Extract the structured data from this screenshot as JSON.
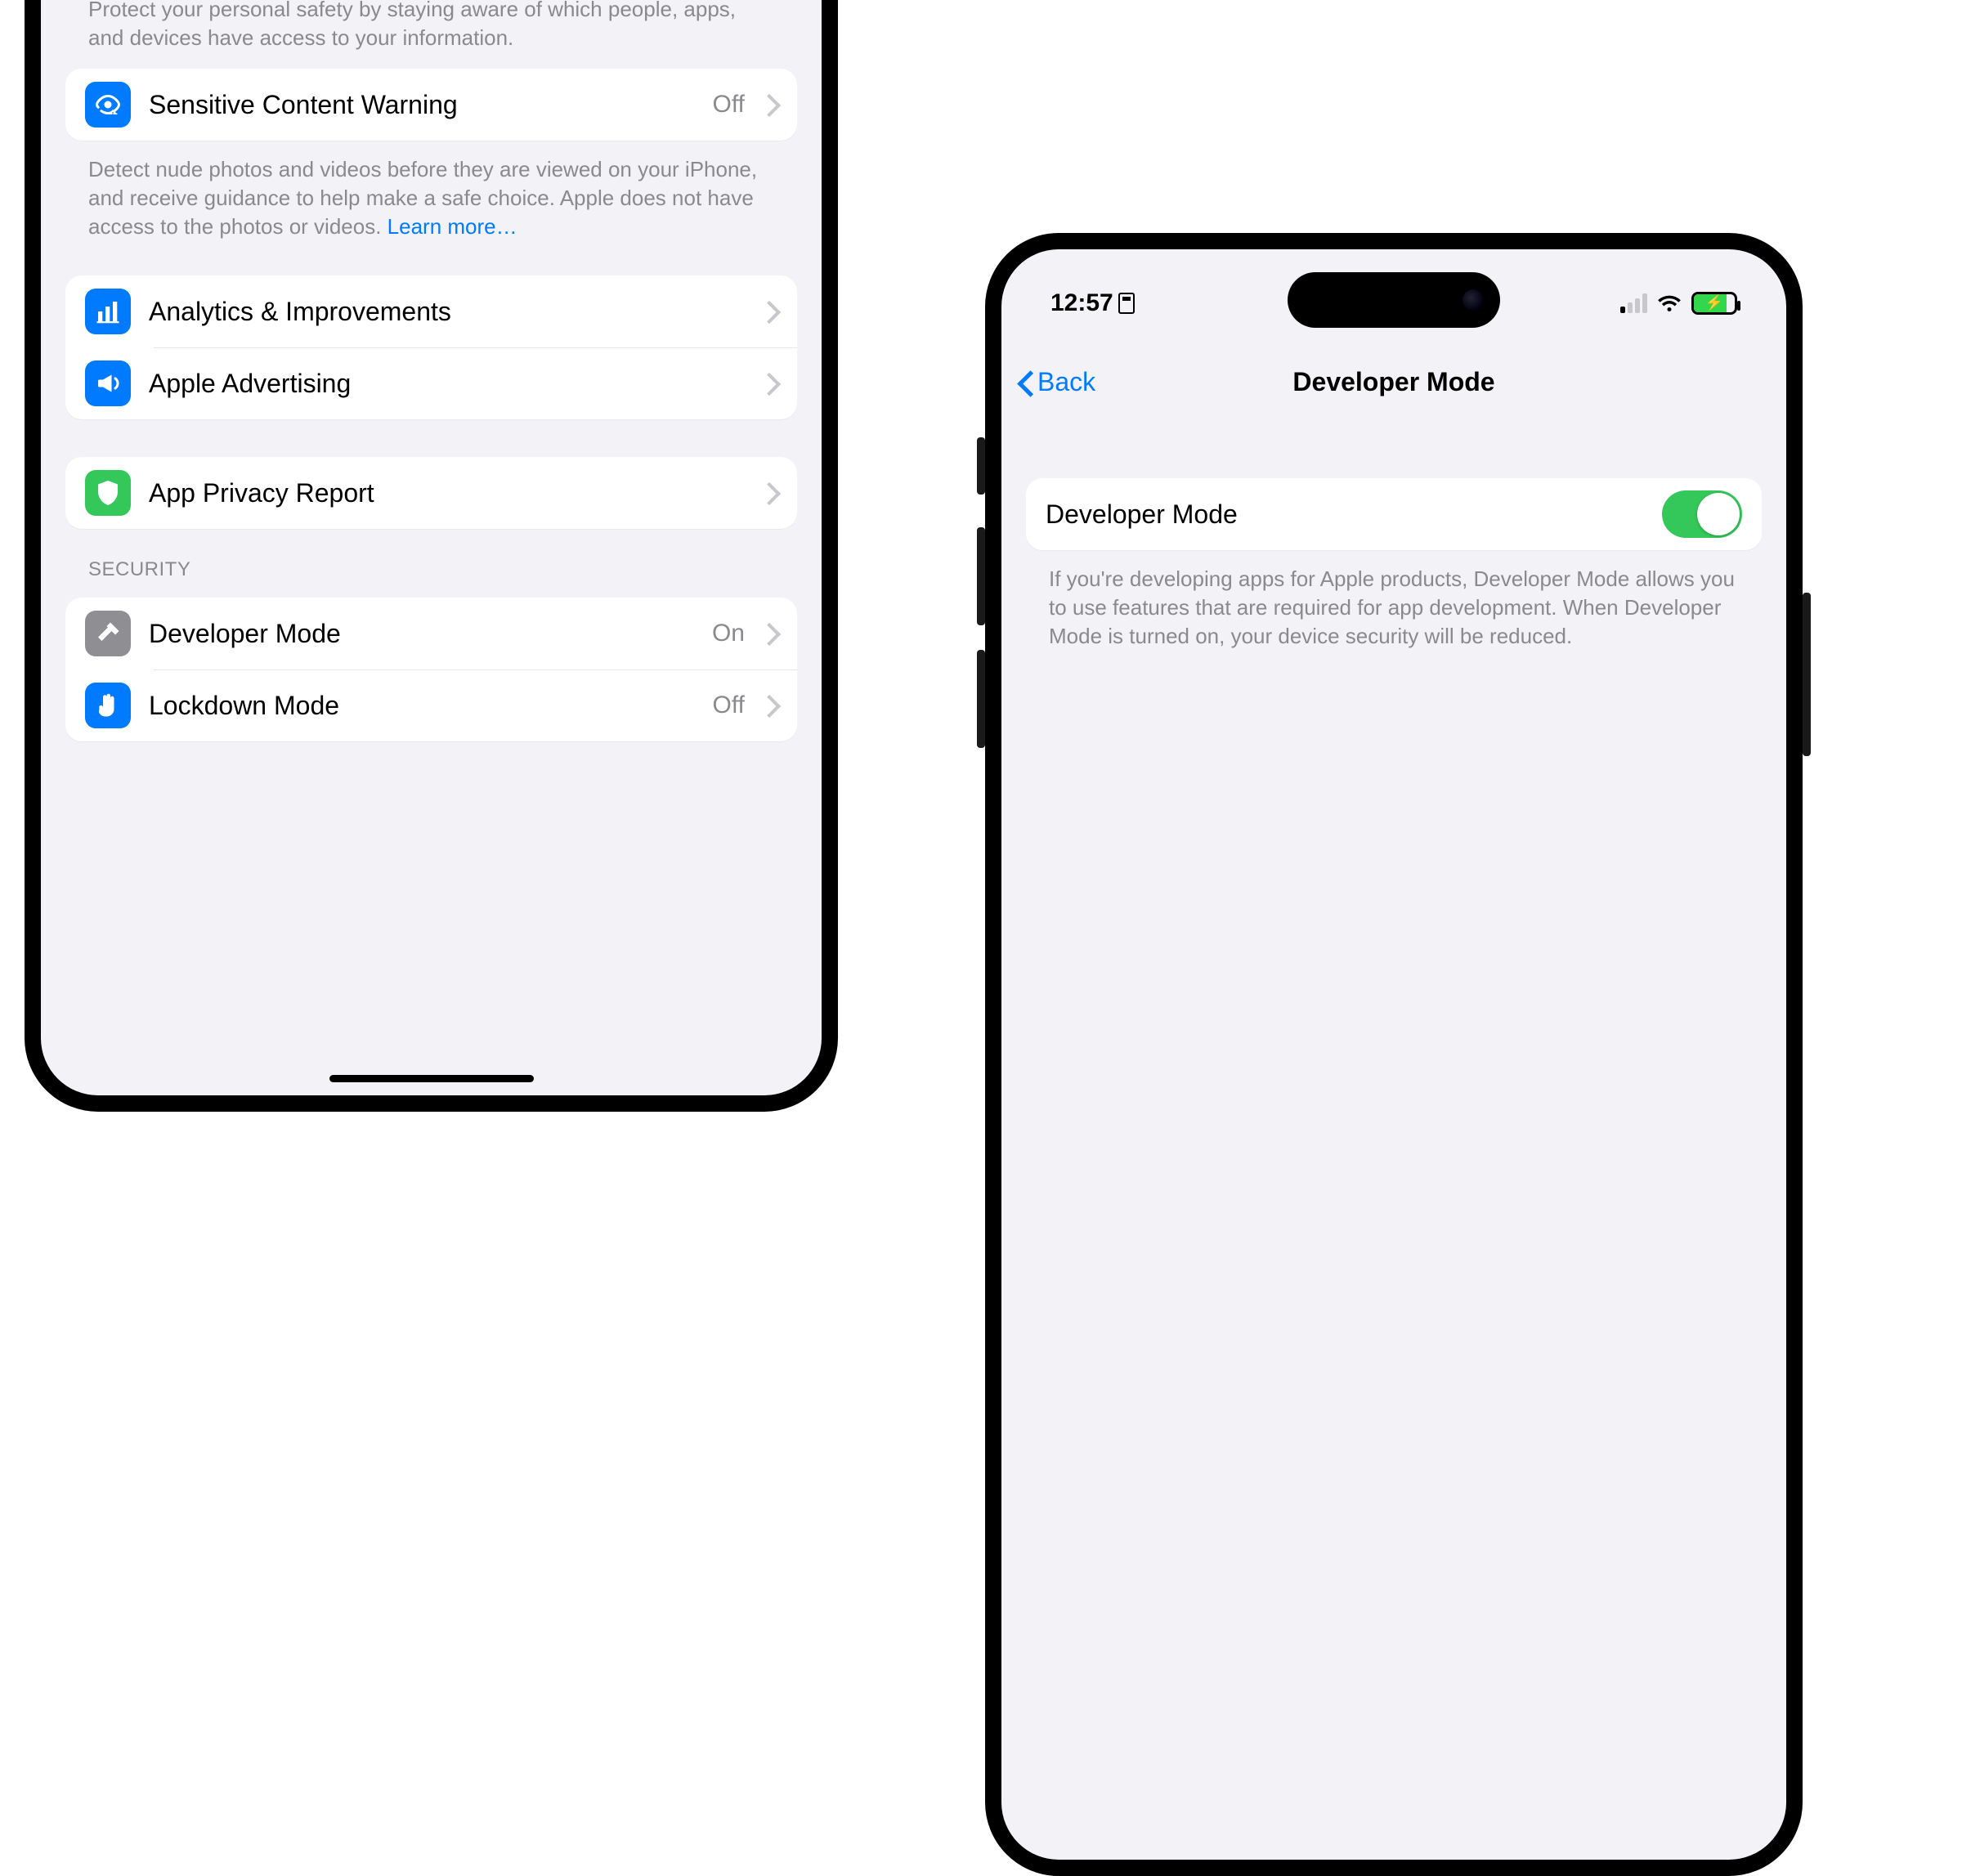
{
  "left": {
    "footer_safety": "Protect your personal safety by staying aware of which people, apps, and devices have access to your information.",
    "rows": {
      "sensitive": {
        "label": "Sensitive Content Warning",
        "value": "Off",
        "footer": "Detect nude photos and videos before they are viewed on your iPhone, and receive guidance to help make a safe choice. Apple does not have access to the photos or videos. ",
        "learn_more": "Learn more…"
      },
      "analytics": {
        "label": "Analytics & Improvements"
      },
      "advertising": {
        "label": "Apple Advertising"
      },
      "privacy_report": {
        "label": "App Privacy Report"
      }
    },
    "security_header": "SECURITY",
    "security": {
      "dev_mode": {
        "label": "Developer Mode",
        "value": "On"
      },
      "lockdown": {
        "label": "Lockdown Mode",
        "value": "Off"
      }
    }
  },
  "right": {
    "status": {
      "time": "12:57"
    },
    "nav": {
      "back": "Back",
      "title": "Developer Mode"
    },
    "row": {
      "label": "Developer Mode",
      "enabled": true
    },
    "footer": "If you're developing apps for Apple products, Developer Mode allows you to use features that are required for app development. When Developer Mode is turned on, your device security will be reduced."
  },
  "colors": {
    "accent": "#007aff",
    "toggle_on": "#34c759"
  }
}
